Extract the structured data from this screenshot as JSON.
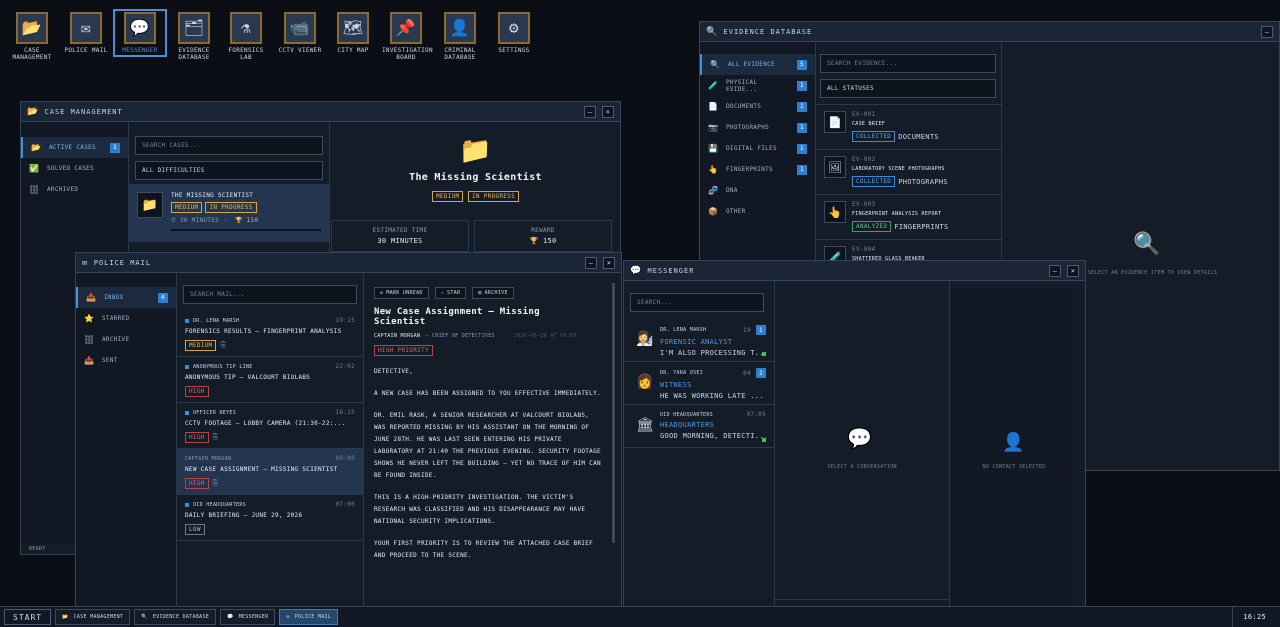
{
  "desktop": {
    "icons": [
      {
        "label": "CASE MANAGEMENT",
        "glyph": "📂",
        "name": "case-management-desktop-icon"
      },
      {
        "label": "POLICE MAIL",
        "glyph": "✉",
        "name": "police-mail-desktop-icon"
      },
      {
        "label": "MESSENGER",
        "glyph": "💬",
        "name": "messenger-desktop-icon"
      },
      {
        "label": "EVIDENCE DATABASE",
        "glyph": "🗂",
        "name": "evidence-database-desktop-icon"
      },
      {
        "label": "FORENSICS LAB",
        "glyph": "⚗",
        "name": "forensics-lab-desktop-icon"
      },
      {
        "label": "CCTV VIEWER",
        "glyph": "📹",
        "name": "cctv-viewer-desktop-icon"
      },
      {
        "label": "CITY MAP",
        "glyph": "🗺",
        "name": "city-map-desktop-icon"
      },
      {
        "label": "INVESTIGATION BOARD",
        "glyph": "📌",
        "name": "investigation-board-desktop-icon"
      },
      {
        "label": "CRIMINAL DATABASE",
        "glyph": "👤",
        "name": "criminal-database-desktop-icon"
      },
      {
        "label": "SETTINGS",
        "glyph": "⚙",
        "name": "settings-desktop-icon"
      }
    ]
  },
  "case_window": {
    "title": "CASE MANAGEMENT",
    "nav": [
      {
        "label": "ACTIVE CASES",
        "count": "1",
        "glyph": "📂"
      },
      {
        "label": "SOLVED CASES",
        "glyph": "✅"
      },
      {
        "label": "ARCHIVED",
        "glyph": "🗄"
      }
    ],
    "search_placeholder": "SEARCH CASES...",
    "difficulty_filter": "ALL DIFFICULTIES",
    "case_item": {
      "title": "THE MISSING SCIENTIST",
      "difficulty": "MEDIUM",
      "status": "IN PROGRESS",
      "duration": "⏱ 30 MINUTES",
      "reward": "🏆 150"
    },
    "detail": {
      "title": "The Missing Scientist",
      "difficulty": "MEDIUM",
      "status": "IN PROGRESS",
      "est_label": "ESTIMATED TIME",
      "est_value": "30 MINUTES",
      "reward_label": "REWARD",
      "reward_value": "🏆 150"
    },
    "status": "READY"
  },
  "evidence_window": {
    "title": "EVIDENCE DATABASE",
    "nav": [
      {
        "label": "ALL EVIDENCE",
        "count": "5",
        "glyph": "🔍"
      },
      {
        "label": "PHYSICAL EVIDE...",
        "count": "1",
        "glyph": "🧪"
      },
      {
        "label": "DOCUMENTS",
        "count": "1",
        "glyph": "📄"
      },
      {
        "label": "PHOTOGRAPHS",
        "count": "1",
        "glyph": "📷"
      },
      {
        "label": "DIGITAL FILES",
        "count": "1",
        "glyph": "💾"
      },
      {
        "label": "FINGERPRINTS",
        "count": "1",
        "glyph": "👆"
      },
      {
        "label": "DNA",
        "count": "",
        "glyph": "🧬"
      },
      {
        "label": "OTHER",
        "count": "",
        "glyph": "📦"
      }
    ],
    "search_placeholder": "SEARCH EVIDENCE...",
    "status_filter": "ALL STATUSES",
    "items": [
      {
        "id": "EV-001",
        "name": "CASE BRIEF",
        "status": "COLLECTED",
        "type": "DOCUMENTS",
        "glyph": "📄"
      },
      {
        "id": "EV-002",
        "name": "LABORATORY SCENE PHOTOGRAPHS",
        "status": "COLLECTED",
        "type": "PHOTOGRAPHS",
        "glyph": "🖼"
      },
      {
        "id": "EV-003",
        "name": "FINGERPRINT ANALYSIS REPORT",
        "status": "ANALYZED",
        "type": "FINGERPRINTS",
        "glyph": "👆"
      },
      {
        "id": "EV-004",
        "name": "SHATTERED GLASS BEAKER",
        "status": "",
        "type": "",
        "glyph": "🧪"
      }
    ],
    "empty_text": "SELECT AN EVIDENCE ITEM TO VIEW DETAILS"
  },
  "mail_window": {
    "title": "POLICE MAIL",
    "nav": [
      {
        "label": "INBOX",
        "count": "4",
        "glyph": "📥"
      },
      {
        "label": "STARRED",
        "glyph": "⭐"
      },
      {
        "label": "ARCHIVE",
        "glyph": "🗄"
      },
      {
        "label": "SENT",
        "glyph": "📤"
      }
    ],
    "search_placeholder": "SEARCH MAIL...",
    "items": [
      {
        "from": "DR. LENA MARSH",
        "time": "19:15",
        "subject": "FORENSICS RESULTS — FINGERPRINT ANALYSIS",
        "priority": "MEDIUM"
      },
      {
        "from": "ANONYMOUS TIP LINE",
        "time": "22:02",
        "subject": "ANONYMOUS TIP — VALCOURT BIOLABS",
        "priority": "HIGH"
      },
      {
        "from": "OFFICER REYES",
        "time": "18:15",
        "subject": "CCTV FOOTAGE — LOBBY CAMERA (21:30-22:...",
        "priority": "HIGH"
      },
      {
        "from": "CAPTAIN MORGAN",
        "time": "09:00",
        "subject": "NEW CASE ASSIGNMENT — MISSING SCIENTIST",
        "priority": "HIGH"
      },
      {
        "from": "OID HEADQUARTERS",
        "time": "07:00",
        "subject": "DAILY BRIEFING — JUNE 29, 2026",
        "priority": "LOW"
      }
    ],
    "reader": {
      "actions": [
        "MARK UNREAD",
        "STAR",
        "ARCHIVE"
      ],
      "subject": "New Case Assignment — Missing Scientist",
      "from": "CAPTAIN MORGAN",
      "from_role": "— CHIEF OF DETECTIVES",
      "date": "2026-06-29 AT 09:00",
      "priority": "HIGH PRIORITY",
      "paragraphs": [
        "DETECTIVE,",
        "A NEW CASE HAS BEEN ASSIGNED TO YOU EFFECTIVE IMMEDIATELY.",
        "DR. EMIL RASK, A SENIOR RESEARCHER AT VALCOURT BIOLABS, WAS REPORTED MISSING BY HIS ASSISTANT ON THE MORNING OF JUNE 28TH. HE WAS LAST SEEN ENTERING HIS PRIVATE LABORATORY AT 21:40 THE PREVIOUS EVENING. SECURITY FOOTAGE SHOWS HE NEVER LEFT THE BUILDING — YET NO TRACE OF HIM CAN BE FOUND INSIDE.",
        "THIS IS A HIGH-PRIORITY INVESTIGATION. THE VICTIM'S RESEARCH WAS CLASSIFIED AND HIS DISAPPEARANCE MAY HAVE NATIONAL SECURITY IMPLICATIONS.",
        "YOUR FIRST PRIORITY IS TO REVIEW THE ATTACHED CASE BRIEF AND PROCEED TO THE SCENE."
      ]
    }
  },
  "messenger_window": {
    "title": "MESSENGER",
    "search_placeholder": "SEARCH...",
    "conversations": [
      {
        "name": "DR. LENA MARSH",
        "time": "19",
        "unread": "1",
        "role": "FORENSIC ANALYST",
        "preview": "I'M ALSO PROCESSING T...",
        "glyph": "👩‍🔬"
      },
      {
        "name": "DR. YARA OSEI",
        "time": "04",
        "unread": "2",
        "role": "WITNESS",
        "preview": "HE WAS WORKING LATE ...",
        "glyph": "👩"
      },
      {
        "name": "OID HEADQUARTERS",
        "time": "07:05",
        "unread": "",
        "role": "HEADQUARTERS",
        "preview": "GOOD MORNING, DETECTI...",
        "glyph": "🏛"
      }
    ],
    "chat_empty": "SELECT A CONVERSATION",
    "contact_empty": "NO CONTACT SELECTED"
  },
  "taskbar": {
    "start": "START",
    "tasks": [
      {
        "label": "CASE MANAGEMENT",
        "glyph": "📂",
        "active": false
      },
      {
        "label": "EVIDENCE DATABASE",
        "glyph": "🔍",
        "active": false
      },
      {
        "label": "MESSENGER",
        "glyph": "💬",
        "active": false
      },
      {
        "label": "POLICE MAIL",
        "glyph": "✉",
        "active": true
      }
    ],
    "clock": "16:25"
  },
  "colors": {
    "accent": "#4a8fd8",
    "badge": "#2f7fd1",
    "medium": "#e7b64f",
    "high": "#e06060",
    "green": "#5cc47a"
  }
}
